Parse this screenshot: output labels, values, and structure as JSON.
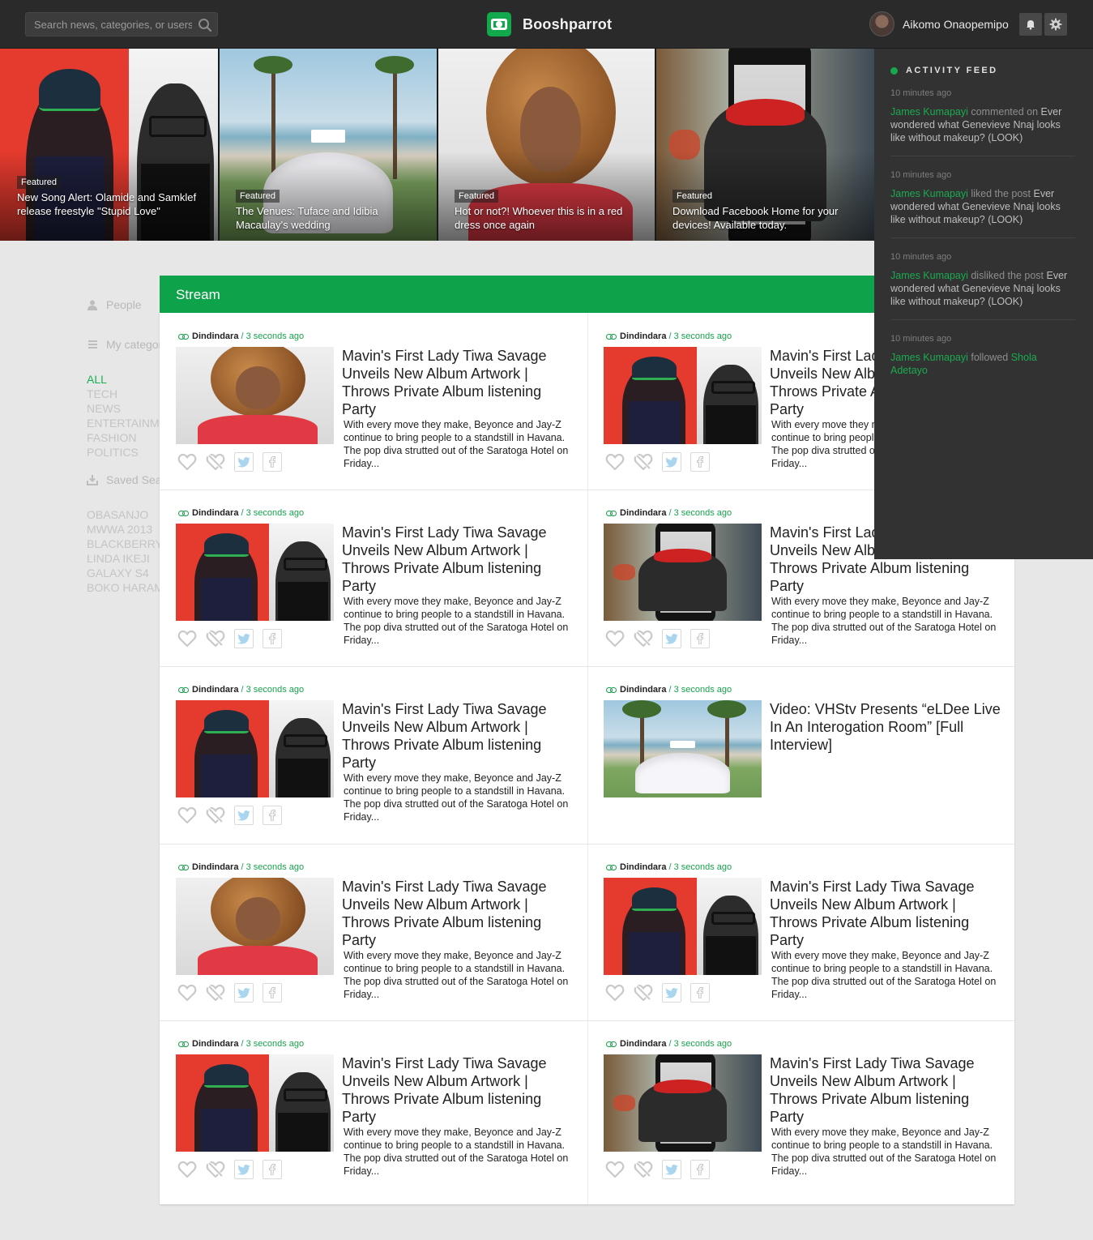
{
  "header": {
    "search_placeholder": "Search news, categories, or users",
    "brand": "Booshparrot",
    "user_name": "Aikomo Onaopemipo"
  },
  "hero": [
    {
      "badge": "Featured",
      "caption": "New Song Alert: Olamide and Samklef release freestyle \"Stupid Love\"",
      "image": "duo-portrait"
    },
    {
      "badge": "Featured",
      "caption": "The Venues: Tuface and Idibia Macaulay's wedding",
      "image": "beach-venue"
    },
    {
      "badge": "Featured",
      "caption": "Hot or not?! Whoever this is in a red dress once again",
      "image": "lady-portrait"
    },
    {
      "badge": "Featured",
      "caption": "Download Facebook Home for your devices! Available today.",
      "image": "phone-cyclist"
    }
  ],
  "activity": {
    "title": "ACTIVITY FEED",
    "items": [
      {
        "time": "10 minutes ago",
        "user": "James Kumapayi",
        "verb": "commented on",
        "text": "Ever wondered what Genevieve Nnaj looks like without makeup? (LOOK)"
      },
      {
        "time": "10 minutes ago",
        "user": "James Kumapayi",
        "verb": "liked the post",
        "text": "Ever wondered what Genevieve Nnaj looks like without makeup? (LOOK)"
      },
      {
        "time": "10 minutes ago",
        "user": "James Kumapayi",
        "verb": "disliked the post",
        "text": "Ever wondered what Genevieve Nnaj looks like without makeup? (LOOK)"
      },
      {
        "time": "10 minutes ago",
        "user": "James Kumapayi",
        "verb": "followed",
        "target": "Shola Adetayo"
      }
    ]
  },
  "sidebar": {
    "people_label": "People",
    "categories_label": "My categories",
    "categories": [
      "ALL",
      "TECH",
      "NEWS",
      "ENTERTAINMENT",
      "FASHION",
      "POLITICS"
    ],
    "active_category": "ALL",
    "saved_label": "Saved Searches",
    "saved": [
      "OBASANJO",
      "MWWA 2013",
      "BLACKBERRY",
      "LINDA IKEJI",
      "GALAXY S4",
      "BOKO HARAM"
    ]
  },
  "stream": {
    "title": "Stream",
    "cards": [
      {
        "author": "Dindindara",
        "time": "/ 3 seconds ago",
        "title": "Mavin's First Lady Tiwa Savage Unveils New Album Artwork | Throws Private Album listening Party",
        "excerpt": "With every move they make, Beyonce and Jay-Z continue to bring people to a standstill in Havana. The pop diva strutted out of the Saratoga Hotel on Friday...",
        "image": "lady-portrait"
      },
      {
        "author": "Dindindara",
        "time": "/ 3 seconds ago",
        "title": "Mavin's First Lady Tiwa Savage Unveils New Album Artwork | Throws Private Album listening Party",
        "excerpt": "With every move they make, Beyonce and Jay-Z continue to bring people to a standstill in Havana. The pop diva strutted out of the Saratoga Hotel on Friday...",
        "image": "duo-portrait"
      },
      {
        "author": "Dindindara",
        "time": "/ 3 seconds ago",
        "title": "Mavin's First Lady Tiwa Savage Unveils New Album Artwork | Throws Private Album listening Party",
        "excerpt": "With every move they make, Beyonce and Jay-Z continue to bring people to a standstill in Havana. The pop diva strutted out of the Saratoga Hotel on Friday...",
        "image": "duo-portrait"
      },
      {
        "author": "Dindindara",
        "time": "/ 3 seconds ago",
        "title": "Mavin's First Lady Tiwa Savage Unveils New Album Artwork | Throws Private Album listening Party",
        "excerpt": "With every move they make, Beyonce and Jay-Z continue to bring people to a standstill in Havana. The pop diva strutted out of the Saratoga Hotel on Friday...",
        "image": "phone-cyclist"
      },
      {
        "author": "Dindindara",
        "time": "/ 3 seconds ago",
        "title": "Mavin's First Lady Tiwa Savage Unveils New Album Artwork | Throws Private Album listening Party",
        "excerpt": "With every move they make, Beyonce and Jay-Z continue to bring people to a standstill in Havana. The pop diva strutted out of the Saratoga Hotel on Friday...",
        "image": "duo-portrait"
      },
      {
        "author": "Dindindara",
        "time": "/ 3 seconds ago",
        "title": "Video: VHStv Presents “eLDee Live In An Interogation Room” [Full Interview]",
        "excerpt": "",
        "image": "beach-venue"
      },
      {
        "author": "Dindindara",
        "time": "/ 3 seconds ago",
        "title": "Mavin's First Lady Tiwa Savage Unveils New Album Artwork | Throws Private Album listening Party",
        "excerpt": "With every move they make, Beyonce and Jay-Z continue to bring people to a standstill in Havana. The pop diva strutted out of the Saratoga Hotel on Friday...",
        "image": "lady-portrait"
      },
      {
        "author": "Dindindara",
        "time": "/ 3 seconds ago",
        "title": "Mavin's First Lady Tiwa Savage Unveils New Album Artwork | Throws Private Album listening Party",
        "excerpt": "With every move they make, Beyonce and Jay-Z continue to bring people to a standstill in Havana. The pop diva strutted out of the Saratoga Hotel on Friday...",
        "image": "duo-portrait"
      },
      {
        "author": "Dindindara",
        "time": "/ 3 seconds ago",
        "title": "Mavin's First Lady Tiwa Savage Unveils New Album Artwork | Throws Private Album listening Party",
        "excerpt": "With every move they make, Beyonce and Jay-Z continue to bring people to a standstill in Havana. The pop diva strutted out of the Saratoga Hotel on Friday...",
        "image": "duo-portrait"
      },
      {
        "author": "Dindindara",
        "time": "/ 3 seconds ago",
        "title": "Mavin's First Lady Tiwa Savage Unveils New Album Artwork | Throws Private Album listening Party",
        "excerpt": "With every move they make, Beyonce and Jay-Z continue to bring people to a standstill in Havana. The pop diva strutted out of the Saratoga Hotel on Friday...",
        "image": "phone-cyclist"
      }
    ],
    "actions": [
      "like-icon",
      "dislike-icon",
      "twitter-icon",
      "facebook-icon"
    ]
  },
  "colors": {
    "accent": "#12a84c",
    "topbar": "#2a2a2a",
    "activity_bg": "#323232",
    "page_bg": "#e7e7e7"
  }
}
